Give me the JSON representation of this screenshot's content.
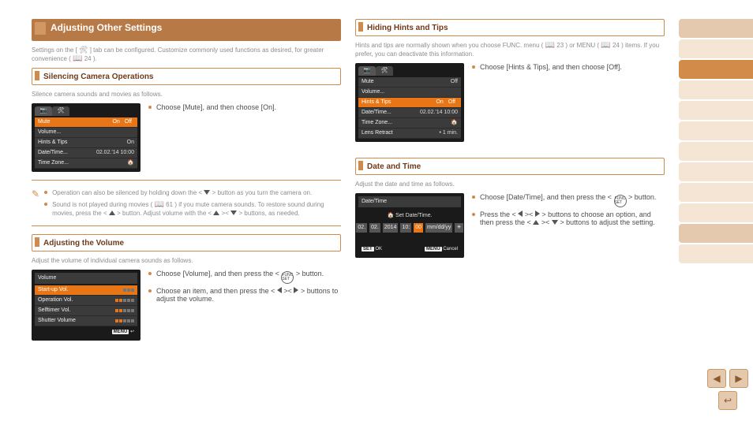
{
  "title_bar": "Adjusting Other Settings",
  "intro_a": "Settings on the [",
  "intro_b": "] tab can be configured. Customize commonly used functions as desired, for greater convenience (",
  "intro_ref": "24",
  "intro_c": ").",
  "sec_silence": {
    "head": "Silencing Camera Operations",
    "body": "Silence camera sounds and movies as follows.",
    "bullet1": "Choose [Mute], and then choose [On].",
    "note1a": "Operation can also be silenced by holding down the <",
    "note1b": "> button as you turn the camera on.",
    "note2a": "Sound is not played during movies (",
    "note_ref": "61",
    "note2b": ") if you mute camera sounds. To restore sound during movies, press the <",
    "note2c": "> button. Adjust volume with the <",
    "note2d": "><",
    "note2e": "> buttons, as needed."
  },
  "sec_volume": {
    "head": "Adjusting the Volume",
    "body": "Adjust the volume of individual camera sounds as follows.",
    "bullet1a": "Choose [Volume], and then press the <",
    "bullet1b": "> button.",
    "bullet2a": "Choose an item, and then press the <",
    "bullet2b": "><",
    "bullet2c": "> buttons to adjust the volume."
  },
  "sec_hints": {
    "head": "Hiding Hints and Tips",
    "body_a": "Hints and tips are normally shown when you choose FUNC. menu (",
    "body_ref1": "23",
    "body_b": ") or MENU (",
    "body_ref2": "24",
    "body_c": ") items. If you prefer, you can deactivate this information.",
    "bullet1": "Choose [Hints & Tips], and then choose [Off]."
  },
  "sec_date": {
    "head": "Date and Time",
    "body": "Adjust the date and time as follows.",
    "bullet1a": "Choose [Date/Time], and then press the <",
    "bullet1b": "> button.",
    "bullet2a": "Press the <",
    "bullet2b": "><",
    "bullet2c": "> buttons to choose an option, and then press the <",
    "bullet2d": "><",
    "bullet2e": "> buttons to adjust the setting."
  },
  "lcd_mute": {
    "rows": [
      {
        "label": "Mute",
        "value": "On",
        "hl": true,
        "onoff": true,
        "on_sel": true
      },
      {
        "label": "Volume...",
        "value": ""
      },
      {
        "label": "Hints & Tips",
        "value": "On"
      },
      {
        "label": "Date/Time...",
        "value": "02.02.'14 10:00"
      },
      {
        "label": "Time Zone...",
        "value": "🏠"
      }
    ]
  },
  "lcd_hints": {
    "rows": [
      {
        "label": "Mute",
        "value": "Off"
      },
      {
        "label": "Volume...",
        "value": ""
      },
      {
        "label": "Hints & Tips",
        "value": "Off",
        "hl": true,
        "onoff": true,
        "on_sel": false
      },
      {
        "label": "Date/Time...",
        "value": "02.02.'14 10:00"
      },
      {
        "label": "Time Zone...",
        "value": "🏠"
      },
      {
        "label": "Lens Retract",
        "value": "• 1 min."
      }
    ]
  },
  "lcd_volume": {
    "title": "Volume",
    "rows": [
      {
        "label": "Start-up Vol.",
        "level": 2,
        "hl": true
      },
      {
        "label": "Operation Vol.",
        "level": 2
      },
      {
        "label": "Selftimer Vol.",
        "level": 2
      },
      {
        "label": "Shutter Volume",
        "level": 2
      }
    ],
    "footer_right": "MENU ↩"
  },
  "lcd_datetime": {
    "title": "Date/Time",
    "sub": "🏠  Set Date/Time.",
    "fields": [
      "02.",
      "02.",
      "2014",
      "10:",
      "00",
      "mm/dd/yy",
      "☀"
    ],
    "hl_index": 4,
    "foot_left": "SET OK",
    "foot_right": "MENU Cancel"
  },
  "nav": {
    "prev": "◀",
    "next": "▶",
    "back": "↩"
  }
}
